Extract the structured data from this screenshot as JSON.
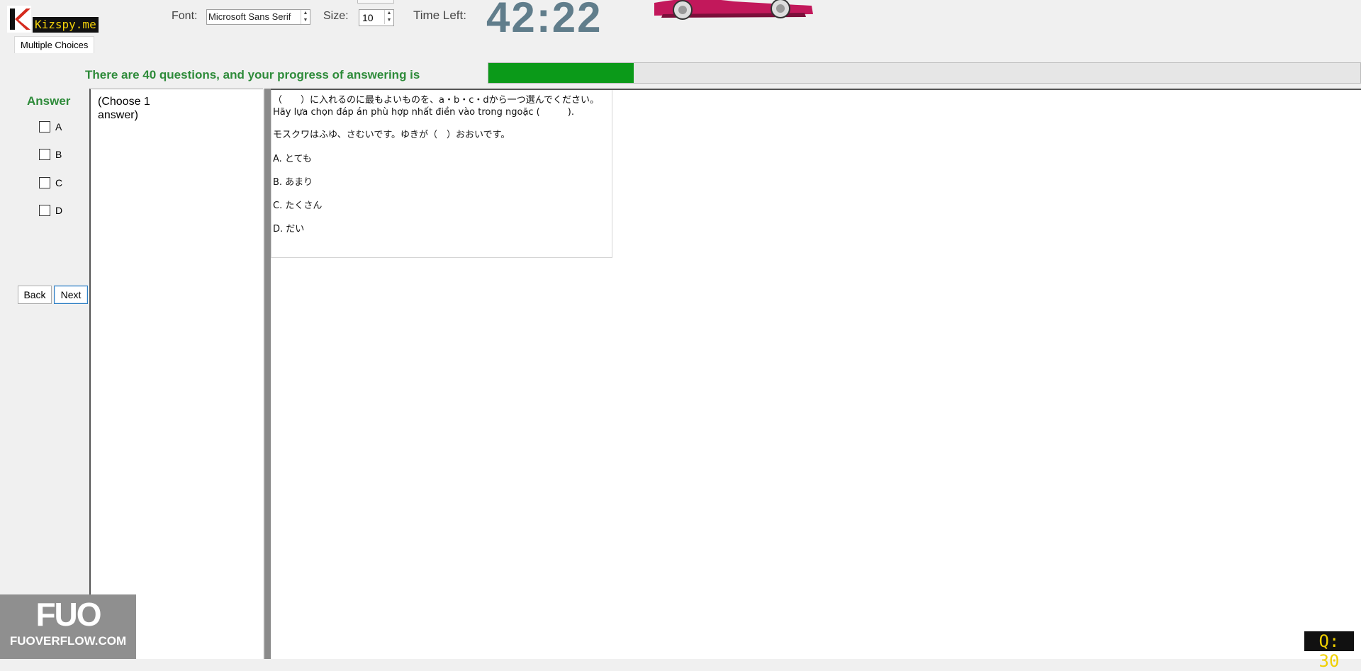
{
  "app": {
    "logo_text": "Kizspy.me"
  },
  "tabs": {
    "active": "Multiple Choices"
  },
  "toolbar": {
    "font_label": "Font:",
    "font_value": "Microsoft Sans Serif",
    "size_label": "Size:",
    "size_value": "10",
    "time_left_label": "Time Left:",
    "timer_value": "42:22"
  },
  "progress": {
    "text": "There are 40 questions, and your progress of answering is",
    "fraction": 0.167
  },
  "answer_panel": {
    "title": "Answer",
    "options": [
      "A",
      "B",
      "C",
      "D"
    ],
    "back_label": "Back",
    "next_label": "Next"
  },
  "choose_hint": "(Choose 1\nanswer)",
  "question": {
    "instruction_jp": "（　　）に入れるのに最もよいものを、a・b・c・dから一つ選んでください。",
    "instruction_vi": "Hãy lựa chọn đáp án phù hợp nhất điền vào trong ngoặc (　　　).",
    "sentence": "モスクワはふゆ、さむいです。ゆきが（　）おおいです。",
    "choices": [
      "A. とても",
      "B. あまり",
      "C. たくさん",
      "D. だい"
    ]
  },
  "watermark": {
    "big": "FUO",
    "small": "FUOVERFLOW.COM"
  },
  "question_counter": "Q: 30",
  "colors": {
    "progress_fill": "#0b9a19",
    "accent_green": "#2e8b3a",
    "timer": "#607d8b"
  }
}
